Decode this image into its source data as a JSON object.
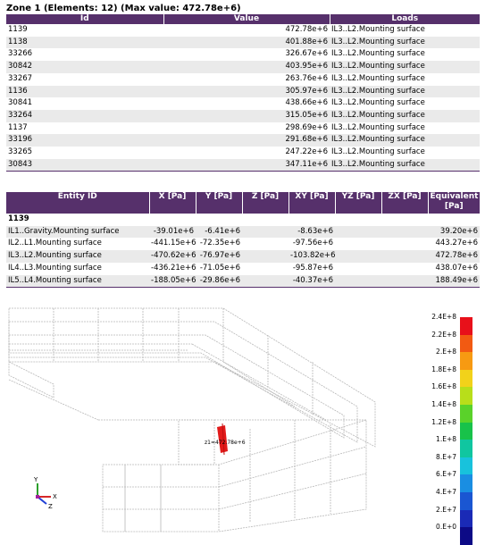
{
  "zone_title": "Zone 1 (Elements: 12) (Max value: 472.78e+6)",
  "table1": {
    "headers": [
      "Id",
      "Value",
      "Loads"
    ],
    "rows": [
      [
        "1139",
        "472.78e+6",
        "IL3..L2.Mounting surface"
      ],
      [
        "1138",
        "401.88e+6",
        "IL3..L2.Mounting surface"
      ],
      [
        "33266",
        "326.67e+6",
        "IL3..L2.Mounting surface"
      ],
      [
        "30842",
        "403.95e+6",
        "IL3..L2.Mounting surface"
      ],
      [
        "33267",
        "263.76e+6",
        "IL3..L2.Mounting surface"
      ],
      [
        "1136",
        "305.97e+6",
        "IL3..L2.Mounting surface"
      ],
      [
        "30841",
        "438.66e+6",
        "IL3..L2.Mounting surface"
      ],
      [
        "33264",
        "315.05e+6",
        "IL3..L2.Mounting surface"
      ],
      [
        "1137",
        "298.69e+6",
        "IL3..L2.Mounting surface"
      ],
      [
        "33196",
        "291.68e+6",
        "IL3..L2.Mounting surface"
      ],
      [
        "33265",
        "247.22e+6",
        "IL3..L2.Mounting surface"
      ],
      [
        "30843",
        "347.11e+6",
        "IL3..L2.Mounting surface"
      ]
    ]
  },
  "table2": {
    "headers": [
      "Entity ID",
      "X [Pa]",
      "Y [Pa]",
      "Z [Pa]",
      "XY [Pa]",
      "YZ [Pa]",
      "ZX [Pa]",
      "Equivalent [Pa]"
    ],
    "group": "1139",
    "rows": [
      [
        "IL1..Gravity.Mounting surface",
        "-39.01e+6",
        "-6.41e+6",
        "",
        "-8.63e+6",
        "",
        "",
        "39.20e+6"
      ],
      [
        "IL2..L1.Mounting surface",
        "-441.15e+6",
        "-72.35e+6",
        "",
        "-97.56e+6",
        "",
        "",
        "443.27e+6"
      ],
      [
        "IL3..L2.Mounting surface",
        "-470.62e+6",
        "-76.97e+6",
        "",
        "-103.82e+6",
        "",
        "",
        "472.78e+6"
      ],
      [
        "IL4..L3.Mounting surface",
        "-436.21e+6",
        "-71.05e+6",
        "",
        "-95.87e+6",
        "",
        "",
        "438.07e+6"
      ],
      [
        "IL5..L4.Mounting surface",
        "-188.05e+6",
        "-29.86e+6",
        "",
        "-40.37e+6",
        "",
        "",
        "188.49e+6"
      ]
    ]
  },
  "probe_label": "z1=472.78e+6",
  "axes": {
    "x": "X",
    "y": "Y",
    "z": "Z"
  },
  "legend": {
    "labels": [
      "2.4E+8",
      "2.2E+8",
      "2.E+8",
      "1.8E+8",
      "1.6E+8",
      "1.4E+8",
      "1.2E+8",
      "1.E+8",
      "8.E+7",
      "6.E+7",
      "4.E+7",
      "2.E+7",
      "0.E+0"
    ],
    "colors": [
      "#e8101a",
      "#f25a12",
      "#f79a12",
      "#f2d21a",
      "#b8de1a",
      "#5ad22a",
      "#18c24a",
      "#10c6a0",
      "#18c2dc",
      "#1a8ee2",
      "#1a56d2",
      "#1a2ab6",
      "#0c0a86"
    ]
  }
}
